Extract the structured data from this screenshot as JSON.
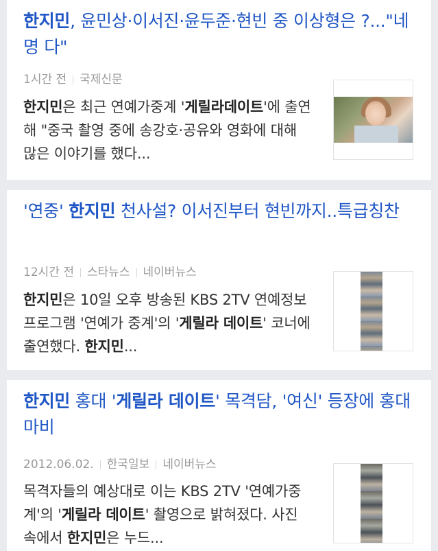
{
  "articles": [
    {
      "title_parts": [
        {
          "text": "한지민",
          "bold": true
        },
        {
          "text": ", 윤민상·이서진·윤두준·현빈 중 이상형은 ?...\"네명 다\"",
          "bold": false
        }
      ],
      "time": "1시간 전",
      "sources": [
        "국제신문"
      ],
      "desc_parts": [
        {
          "text": "한지민",
          "bold": true
        },
        {
          "text": "은 최근 연예가중계 '",
          "bold": false
        },
        {
          "text": "게릴라데이트",
          "bold": true
        },
        {
          "text": "'에 출연해 \"중국 촬영 중에 송강호·공유와 영화에 대해 많은 이야기를 했다...",
          "bold": false
        }
      ],
      "thumbnail": "actress-photo"
    },
    {
      "title_parts": [
        {
          "text": "'연중' ",
          "bold": false
        },
        {
          "text": "한지민",
          "bold": true
        },
        {
          "text": " 천사설? 이서진부터 현빈까지..특급칭찬",
          "bold": false
        }
      ],
      "time": "12시간 전",
      "sources": [
        "스타뉴스",
        "네이버뉴스"
      ],
      "desc_parts": [
        {
          "text": "한지민",
          "bold": true
        },
        {
          "text": "은 10일 오후 방송된 KBS 2TV 연예정보프로그램 '연예가 중계'의 '",
          "bold": false
        },
        {
          "text": "게릴라 데이트",
          "bold": true
        },
        {
          "text": "' 코너에 출연했다. ",
          "bold": false
        },
        {
          "text": "한지민",
          "bold": true
        },
        {
          "text": "...",
          "bold": false
        }
      ],
      "thumbnail": "photo-strip"
    },
    {
      "title_parts": [
        {
          "text": "한지민",
          "bold": true
        },
        {
          "text": " 홍대 '",
          "bold": false
        },
        {
          "text": "게릴라 데이트",
          "bold": true
        },
        {
          "text": "' 목격담, '여신' 등장에 홍대 마비",
          "bold": false
        }
      ],
      "time": "2012.06.02.",
      "sources": [
        "한국일보",
        "네이버뉴스"
      ],
      "desc_parts": [
        {
          "text": "목격자들의 예상대로 이는 KBS 2TV '연예가중계'의 '",
          "bold": false
        },
        {
          "text": "게릴라 데이트",
          "bold": true
        },
        {
          "text": "' 촬영으로 밝혀졌다. 사진 속에서 ",
          "bold": false
        },
        {
          "text": "한지민",
          "bold": true
        },
        {
          "text": "은 누드...",
          "bold": false
        }
      ],
      "thumbnail": "photo-strip"
    }
  ],
  "colors": {
    "title": "#1f56c5",
    "meta": "#9a9a9a",
    "desc": "#333333",
    "background": "#e9ebee"
  }
}
